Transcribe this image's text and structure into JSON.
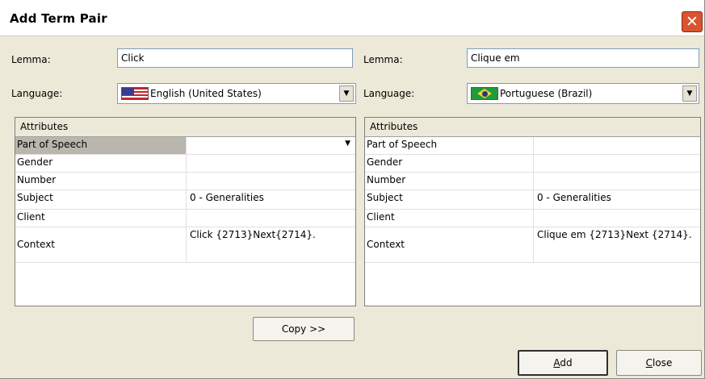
{
  "dialog": {
    "title": "Add Term Pair",
    "close_glyph": "✕"
  },
  "left": {
    "lemma_label": "Lemma:",
    "lemma_value": "Click",
    "language_label": "Language:",
    "language_value": "English (United States)",
    "flag_icon": "us-flag-icon",
    "grid_header": "Attributes",
    "rows": [
      {
        "name": "Part of Speech",
        "value": "",
        "dropdown": "▼"
      },
      {
        "name": "Gender",
        "value": ""
      },
      {
        "name": "Number",
        "value": ""
      },
      {
        "name": "Subject",
        "value": "0 - Generalities"
      },
      {
        "name": "Client",
        "value": ""
      },
      {
        "name": "Context",
        "value": "Click {2713}Next{2714}."
      }
    ]
  },
  "right": {
    "lemma_label": "Lemma:",
    "lemma_value": "Clique em",
    "language_label": "Language:",
    "language_value": "Portuguese (Brazil)",
    "flag_icon": "brazil-flag-icon",
    "grid_header": "Attributes",
    "rows": [
      {
        "name": "Part of Speech",
        "value": ""
      },
      {
        "name": "Gender",
        "value": ""
      },
      {
        "name": "Number",
        "value": ""
      },
      {
        "name": "Subject",
        "value": "0 - Generalities"
      },
      {
        "name": "Client",
        "value": ""
      },
      {
        "name": "Context",
        "value": "Clique em {2713}Next {2714}."
      }
    ]
  },
  "buttons": {
    "copy": "Copy >>",
    "add_underline": "A",
    "add_rest": "dd",
    "close_underline": "C",
    "close_rest": "lose"
  },
  "combo_arrow": "▼"
}
